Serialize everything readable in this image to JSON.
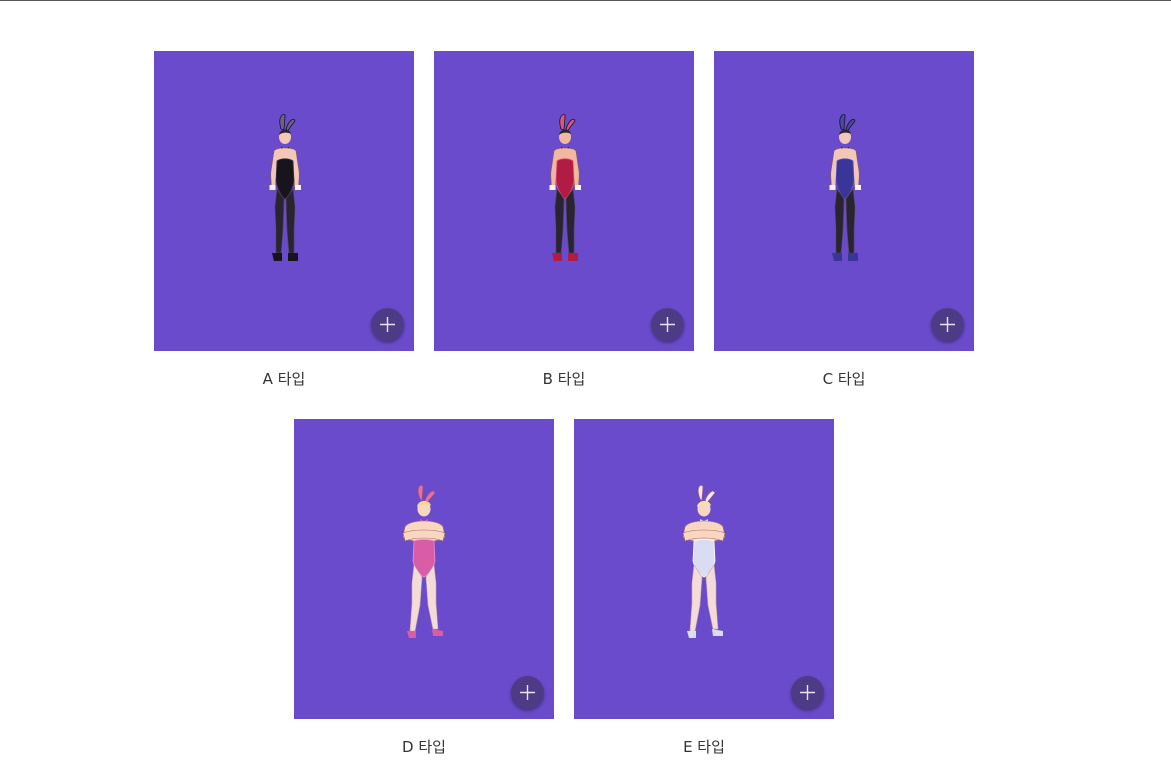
{
  "colors": {
    "tile_background": "#6a4bcc",
    "plus_button": "#4d3b86",
    "caption_text": "#333333"
  },
  "gallery": {
    "items": [
      {
        "label": "A 타입",
        "outfit": "#17141d",
        "trim": "#3a3440",
        "ears": "#6b5f8c",
        "skin": "#f3c7b8",
        "hair": "#2b2533",
        "pose": "hands-down",
        "add_icon": "plus-icon"
      },
      {
        "label": "B 타입",
        "outfit": "#b21c44",
        "trim": "#e04c76",
        "ears": "#d9577d",
        "skin": "#f1b79f",
        "hair": "#2b2533",
        "pose": "hands-down",
        "add_icon": "plus-icon"
      },
      {
        "label": "C 타입",
        "outfit": "#3a3599",
        "trim": "#5c57c4",
        "ears": "#4b46a8",
        "skin": "#f3c7b8",
        "hair": "#2b2533",
        "pose": "hands-down",
        "add_icon": "plus-icon"
      },
      {
        "label": "D 타입",
        "outfit": "#d85ca6",
        "trim": "#f08cc8",
        "ears": "#e46fae",
        "skin": "#f8d6c2",
        "hair": "#f4d98a",
        "pose": "arms-crossed",
        "add_icon": "plus-icon"
      },
      {
        "label": "E 타입",
        "outfit": "#d9dcf2",
        "trim": "#ffffff",
        "ears": "#e9eaf6",
        "skin": "#f8d6c2",
        "hair": "#f4e3a8",
        "pose": "arms-crossed",
        "add_icon": "plus-icon"
      }
    ]
  }
}
